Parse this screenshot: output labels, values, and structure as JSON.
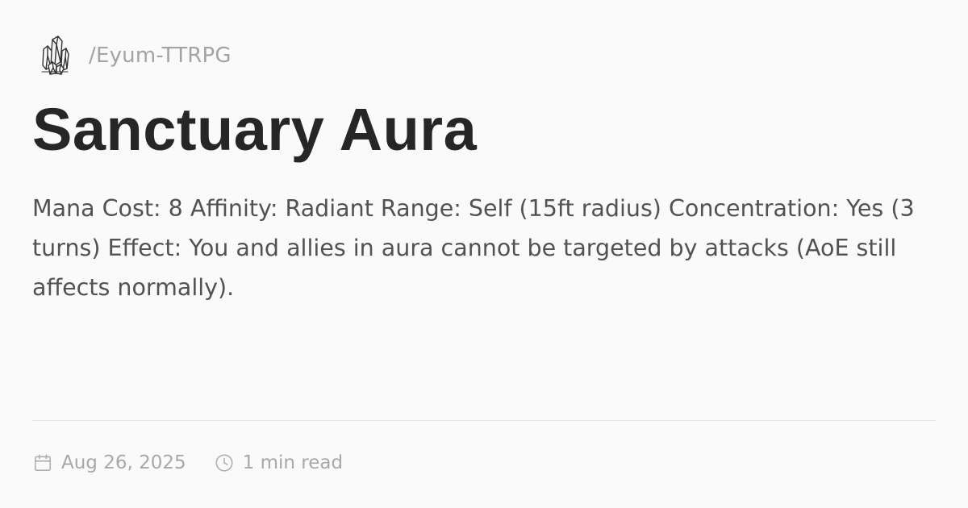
{
  "header": {
    "logo_icon": "crystal-cluster-icon",
    "path": "/Eyum-TTRPG"
  },
  "page": {
    "title": "Sanctuary Aura",
    "description": "Mana Cost: 8 Affinity: Radiant Range: Self (15ft radius) Concentration: Yes (3 turns) Effect: You and allies in aura cannot be targeted by attacks (AoE still affects normally)."
  },
  "meta": {
    "date_icon": "calendar-icon",
    "date": "Aug 26, 2025",
    "read_time_icon": "clock-icon",
    "read_time": "1 min read"
  },
  "colors": {
    "background": "#fafafa",
    "title": "#262626",
    "body_text": "#525252",
    "muted": "#a3a3a3",
    "divider": "#e6e6e6"
  }
}
